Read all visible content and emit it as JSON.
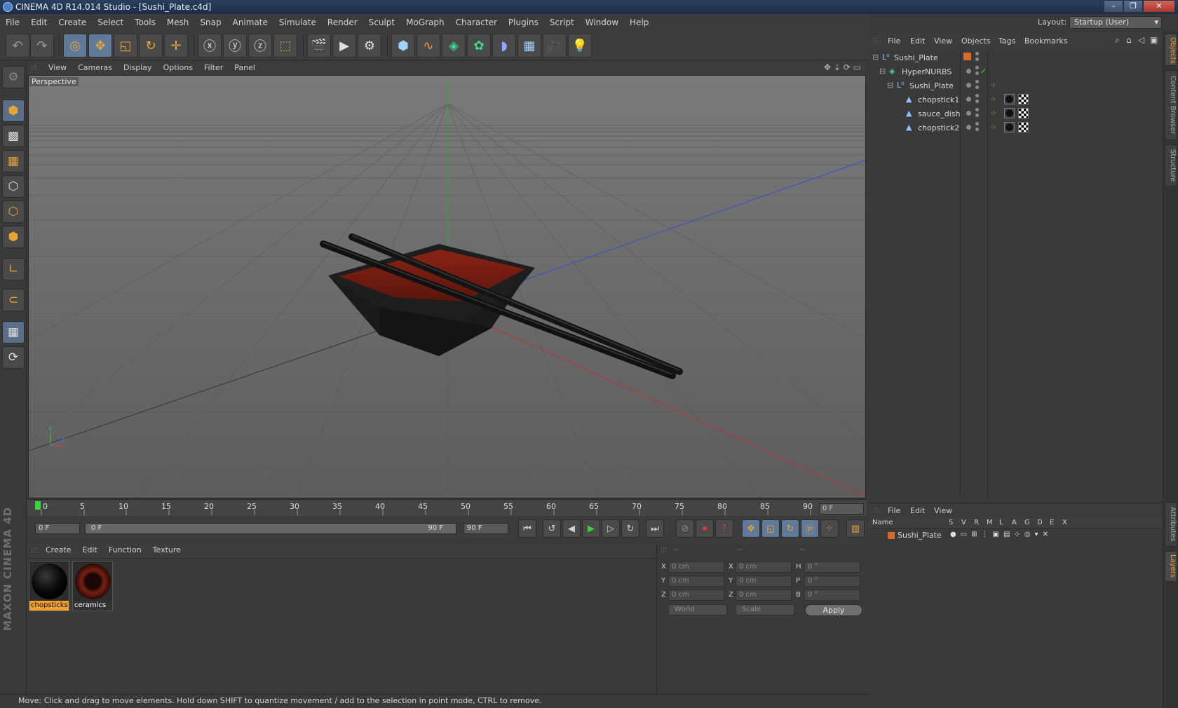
{
  "window": {
    "title": "CINEMA 4D R14.014 Studio - [Sushi_Plate.c4d]",
    "controls": {
      "minimize": "–",
      "maximize": "❐",
      "close": "✕"
    }
  },
  "menubar": [
    "File",
    "Edit",
    "Create",
    "Select",
    "Tools",
    "Mesh",
    "Snap",
    "Animate",
    "Simulate",
    "Render",
    "Sculpt",
    "MoGraph",
    "Character",
    "Plugins",
    "Script",
    "Window",
    "Help"
  ],
  "layout": {
    "label": "Layout:",
    "value": "Startup (User)"
  },
  "toolbar": [
    "undo-icon",
    "redo-icon",
    "live-selection-icon",
    "move-icon",
    "scale-icon",
    "rotate-icon",
    "add-object-icon",
    "x-axis-icon",
    "y-axis-icon",
    "z-axis-icon",
    "coordinate-system-icon",
    "render-view-icon",
    "render-picture-viewer-icon",
    "render-settings-icon",
    "cube-icon",
    "spline-icon",
    "nurbs-icon",
    "array-icon",
    "deformer-icon",
    "floor-icon",
    "camera-icon",
    "light-icon"
  ],
  "viewport": {
    "menu": [
      "View",
      "Cameras",
      "Display",
      "Options",
      "Filter",
      "Panel"
    ],
    "label": "Perspective",
    "axis": {
      "y": "Y",
      "z": "Z",
      "x": "X"
    }
  },
  "timeline": {
    "ticks": [
      "0",
      "5",
      "10",
      "15",
      "20",
      "25",
      "30",
      "35",
      "40",
      "45",
      "50",
      "55",
      "60",
      "65",
      "70",
      "75",
      "80",
      "85",
      "90"
    ],
    "current_frame": "0 F"
  },
  "transport": {
    "start": "0 F",
    "range_start": "0 F",
    "range_end": "90 F",
    "end": "90 F"
  },
  "materials": {
    "menu": [
      "Create",
      "Edit",
      "Function",
      "Texture"
    ],
    "items": [
      {
        "name": "chopsticks",
        "selected": true
      },
      {
        "name": "ceramics",
        "selected": false
      }
    ]
  },
  "coords": {
    "header": [
      "--",
      "--",
      "--"
    ],
    "rows": [
      {
        "l1": "X",
        "v1": "0 cm",
        "l2": "X",
        "v2": "0 cm",
        "l3": "H",
        "v3": "0 °"
      },
      {
        "l1": "Y",
        "v1": "0 cm",
        "l2": "Y",
        "v2": "0 cm",
        "l3": "P",
        "v3": "0 °"
      },
      {
        "l1": "Z",
        "v1": "0 cm",
        "l2": "Z",
        "v2": "0 cm",
        "l3": "B",
        "v3": "0 °"
      }
    ],
    "space": "World",
    "mode": "Scale",
    "apply": "Apply"
  },
  "status": "Move: Click and drag to move elements. Hold down SHIFT to quantize movement / add to the selection in point mode, CTRL to remove.",
  "object_manager": {
    "menu": [
      "File",
      "Edit",
      "View",
      "Objects",
      "Tags",
      "Bookmarks"
    ],
    "objects": [
      {
        "name": "Sushi_Plate",
        "type": "null"
      },
      {
        "name": "HyperNURBS",
        "type": "hypernurbs"
      },
      {
        "name": "Sushi_Plate",
        "type": "null"
      },
      {
        "name": "chopstick1",
        "type": "polygon"
      },
      {
        "name": "sauce_dish",
        "type": "polygon"
      },
      {
        "name": "chopstick2",
        "type": "polygon"
      }
    ]
  },
  "layers": {
    "menu": [
      "File",
      "Edit",
      "View"
    ],
    "columns": [
      "Name",
      "S",
      "V",
      "R",
      "M",
      "L",
      "A",
      "G",
      "D",
      "E",
      "X"
    ],
    "rows": [
      {
        "name": "Sushi_Plate",
        "color": "#d86a2a"
      }
    ]
  },
  "right_tabs": [
    "Objects",
    "Content Browser",
    "Structure",
    "Attributes",
    "Layers"
  ],
  "brand": "MAXON CINEMA 4D",
  "colors": {
    "accent": "#f0a030",
    "selection": "#f0a030",
    "x_axis": "#c03030",
    "y_axis": "#2ab02a",
    "z_axis": "#3050d0"
  }
}
